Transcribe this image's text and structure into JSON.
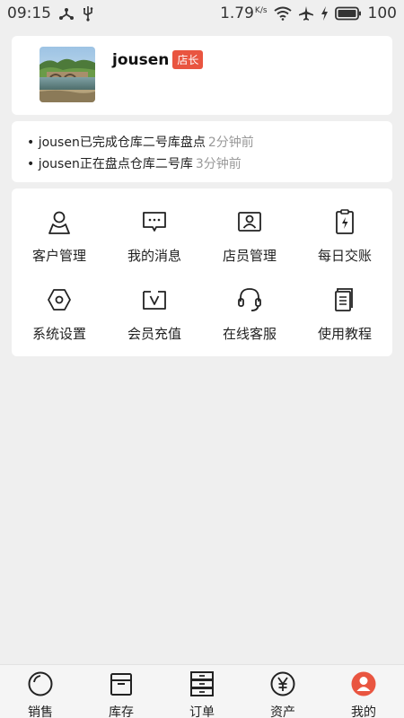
{
  "status_bar": {
    "time": "09:15",
    "speed": "1.79",
    "speed_unit": "K/s",
    "battery": "100",
    "icons": [
      "share-icon",
      "usb-icon",
      "wifi-icon",
      "airplane-icon",
      "charging-icon",
      "battery-icon"
    ]
  },
  "profile": {
    "username": "jousen",
    "role": "店长",
    "avatar": "landscape-photo",
    "badge_color": "#e95540"
  },
  "activity": [
    {
      "text": "• jousen已完成仓库二号库盘点",
      "time": "2分钟前"
    },
    {
      "text": "• jousen正在盘点仓库二号库",
      "time": "3分钟前"
    }
  ],
  "grid": [
    {
      "label": "客户管理",
      "icon": "customer-icon"
    },
    {
      "label": "我的消息",
      "icon": "message-icon"
    },
    {
      "label": "店员管理",
      "icon": "staff-icon"
    },
    {
      "label": "每日交账",
      "icon": "daily-settlement-icon"
    },
    {
      "label": "系统设置",
      "icon": "settings-icon"
    },
    {
      "label": "会员充值",
      "icon": "member-recharge-icon"
    },
    {
      "label": "在线客服",
      "icon": "headset-icon"
    },
    {
      "label": "使用教程",
      "icon": "tutorial-icon"
    }
  ],
  "bottom_nav": [
    {
      "label": "销售",
      "icon": "sales-icon"
    },
    {
      "label": "库存",
      "icon": "inventory-icon"
    },
    {
      "label": "订单",
      "icon": "orders-icon"
    },
    {
      "label": "资产",
      "icon": "assets-icon"
    },
    {
      "label": "我的",
      "icon": "profile-icon",
      "active": true
    }
  ],
  "colors": {
    "background": "#efefef",
    "accent": "#e95540",
    "card": "#ffffff",
    "muted_text": "#999999"
  }
}
